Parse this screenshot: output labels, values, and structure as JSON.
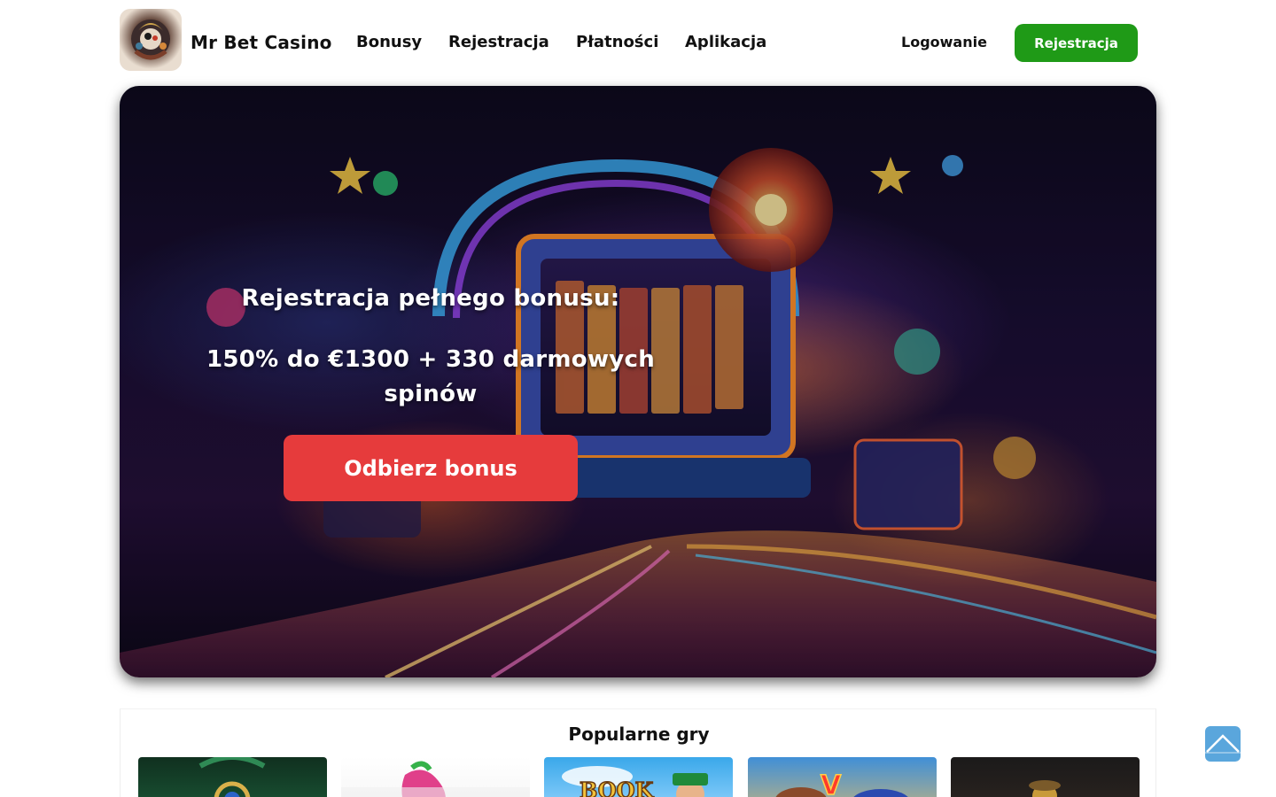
{
  "header": {
    "brand": "Mr Bet Casino",
    "nav": [
      "Bonusy",
      "Rejestracja",
      "Płatności",
      "Aplikacja"
    ],
    "login_label": "Logowanie",
    "register_label": "Rejestracja"
  },
  "hero": {
    "title": "Rejestracja pełnego bonusu:",
    "subtitle": "150% do €1300 + 330 darmowych spinów",
    "cta_label": "Odbierz bonus"
  },
  "popular": {
    "title": "Popularne gry",
    "game3_text": "BOOK",
    "game4_text": "V"
  },
  "colors": {
    "register_green": "#1f9a17",
    "cta_red": "#e63b3c",
    "scroll_top_blue": "#5aa6dc"
  },
  "icons": {
    "logo": "casino-logo-icon",
    "scroll_top": "chevron-up-icon"
  }
}
